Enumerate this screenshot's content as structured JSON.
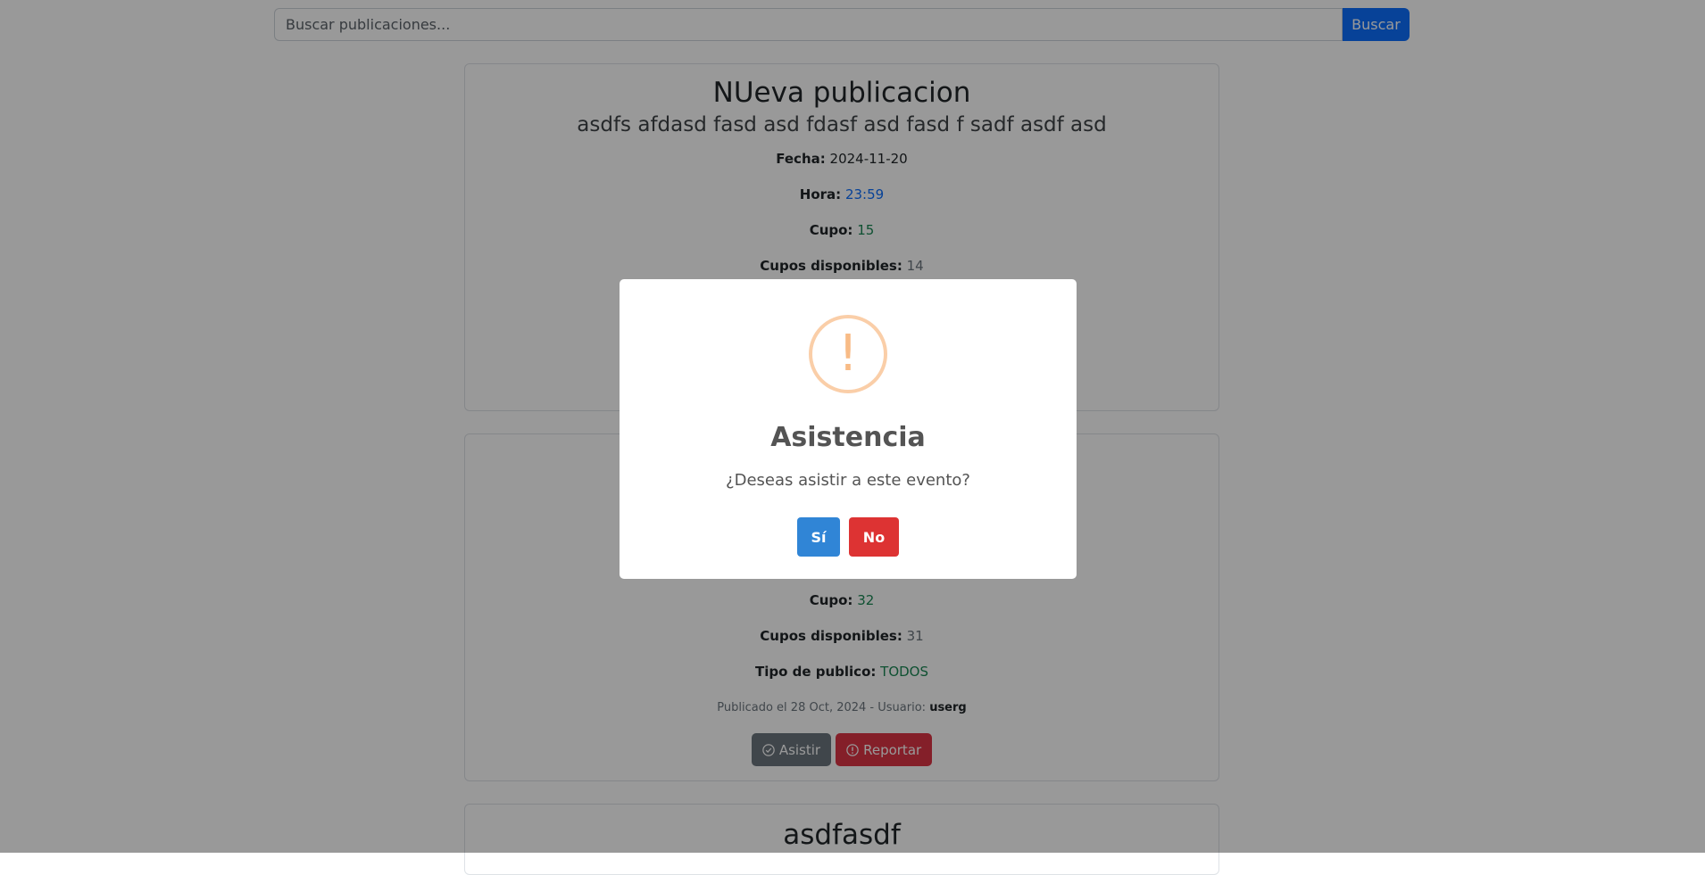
{
  "search": {
    "placeholder": "Buscar publicaciones...",
    "button_label": "Buscar"
  },
  "posts": [
    {
      "title": "NUeva publicacion",
      "description": "asdfs afdasd fasd asd fdasf asd fasd f sadf asdf asd",
      "fecha_label": "Fecha:",
      "fecha": "2024-11-20",
      "hora_label": "Hora:",
      "hora": "23:59",
      "cupo_label": "Cupo:",
      "cupo": "15",
      "disponibles_label": "Cupos disponibles:",
      "disponibles": "14"
    },
    {
      "cupo_label": "Cupo:",
      "cupo": "32",
      "disponibles_label": "Cupos disponibles:",
      "disponibles": "31",
      "publico_label": "Tipo de publico:",
      "publico": "TODOS",
      "published_prefix": "Publicado el 28 Oct, 2024 - Usuario:",
      "user": "userg",
      "asistir_label": "Asistir",
      "reportar_label": "Reportar"
    },
    {
      "title": "asdfasdf"
    }
  ],
  "modal": {
    "icon": "warning-icon",
    "icon_glyph": "!",
    "title": "Asistencia",
    "text": "¿Deseas asistir a este evento?",
    "confirm_label": "Sí",
    "cancel_label": "No"
  },
  "colors": {
    "search_button": "#0d6efd",
    "confirm": "#3085d6",
    "cancel": "#dd3333",
    "warning": "#f8bb86"
  }
}
